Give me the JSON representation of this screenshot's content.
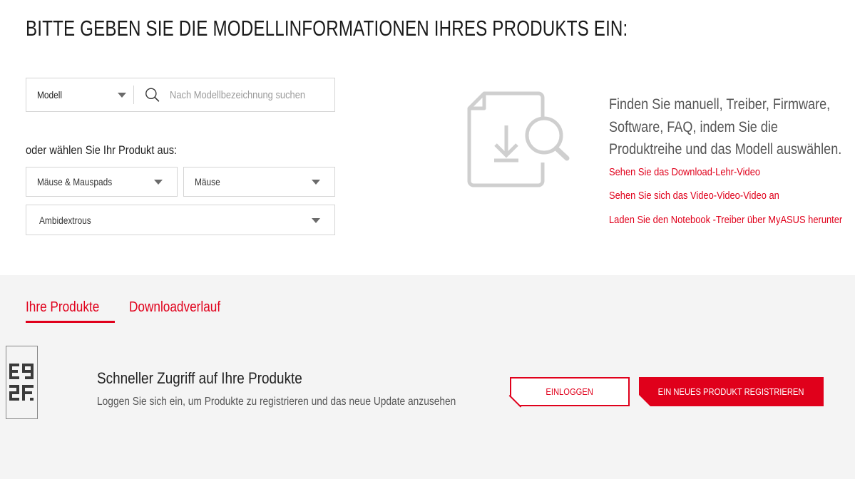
{
  "header": {
    "title": "BITTE GEBEN SIE DIE MODELLINFORMATIONEN IHRES PRODUKTS EIN:"
  },
  "search": {
    "type_select_value": "Modell",
    "placeholder": "Nach Modellbezeichnung suchen"
  },
  "product_picker": {
    "label": "oder wählen Sie Ihr Produkt aus:",
    "category": "Mäuse & Mauspads",
    "subcategory": "Mäuse",
    "series": "Ambidextrous"
  },
  "info": {
    "text": "Finden Sie manuell, Treiber, Firmware, Software, FAQ, indem Sie die Produktreihe und das Modell auswählen.",
    "links": [
      "Sehen Sie das Download-Lehr-Video",
      "Sehen Sie sich das Video-Video-Video an",
      "Laden Sie den Notebook -Treiber über MyASUS herunter"
    ]
  },
  "tabs": [
    {
      "label": "Ihre Produkte",
      "active": true
    },
    {
      "label": "Downloadverlauf",
      "active": false
    }
  ],
  "quick_access": {
    "title": "Schneller Zugriff auf Ihre Produkte",
    "subtitle": "Loggen Sie sich ein, um Produkte zu registrieren und das neue Update anzusehen",
    "login_label": "EINLOGGEN",
    "register_label": "EIN NEUES PRODUKT REGISTRIEREN",
    "code_lines": [
      "E9",
      "2F"
    ]
  },
  "colors": {
    "accent": "#e0001b",
    "panel_bg": "#f4f4f4",
    "border": "#d5d5d5"
  }
}
